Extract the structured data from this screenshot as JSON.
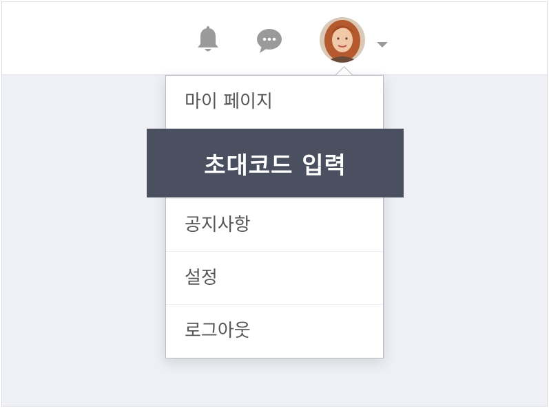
{
  "header": {
    "icons": {
      "notifications": "bell-icon",
      "messages": "chat-bubble-icon",
      "profile_menu": "chevron-down-icon"
    }
  },
  "menu": {
    "items": [
      {
        "label": "마이 페이지"
      },
      {
        "label": "초대코드 입력"
      },
      {
        "label": "공지사항"
      },
      {
        "label": "설정"
      },
      {
        "label": "로그아웃"
      }
    ]
  },
  "colors": {
    "highlight": "#4a5060",
    "icon": "#9a9a9a",
    "background": "#eef0f5"
  }
}
